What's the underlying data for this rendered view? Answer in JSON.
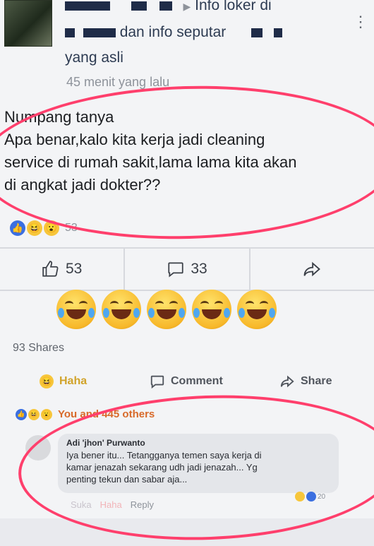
{
  "post": {
    "group_line1": "Info loker di",
    "group_line2": "dan info seputar",
    "group_line3": "yang asli",
    "timestamp": "45 menit yang lalu",
    "text_lines": [
      "Numpang tanya",
      "Apa benar,kalo kita kerja jadi cleaning",
      "service di rumah sakit,lama lama kita akan",
      "di angkat jadi dokter??"
    ],
    "reaction_count": "53"
  },
  "actions": {
    "like_count": "53",
    "comment_count": "33"
  },
  "emoji_row": [
    "joy-emoji",
    "joy-emoji",
    "joy-emoji",
    "joy-emoji",
    "joy-emoji"
  ],
  "shares": "93 Shares",
  "bar": {
    "haha_label": "Haha",
    "comment_label": "Comment",
    "share_label": "Share"
  },
  "reactions_summary": "You and 445 others",
  "comment": {
    "author": "Adi 'jhon' Purwanto",
    "lines": [
      "Iya bener itu... Tetangganya temen saya kerja di",
      "kamar jenazah sekarang udh jadi jenazah... Yg",
      "penting tekun dan sabar aja..."
    ],
    "reaction_count": "20",
    "actions": {
      "like": "Suka",
      "haha": "Haha",
      "reply": "Reply"
    }
  },
  "colors": {
    "highlight_ring": "#ff3f6c",
    "like_blue": "#3b6fe0",
    "haha_yellow": "#f7c63b"
  }
}
